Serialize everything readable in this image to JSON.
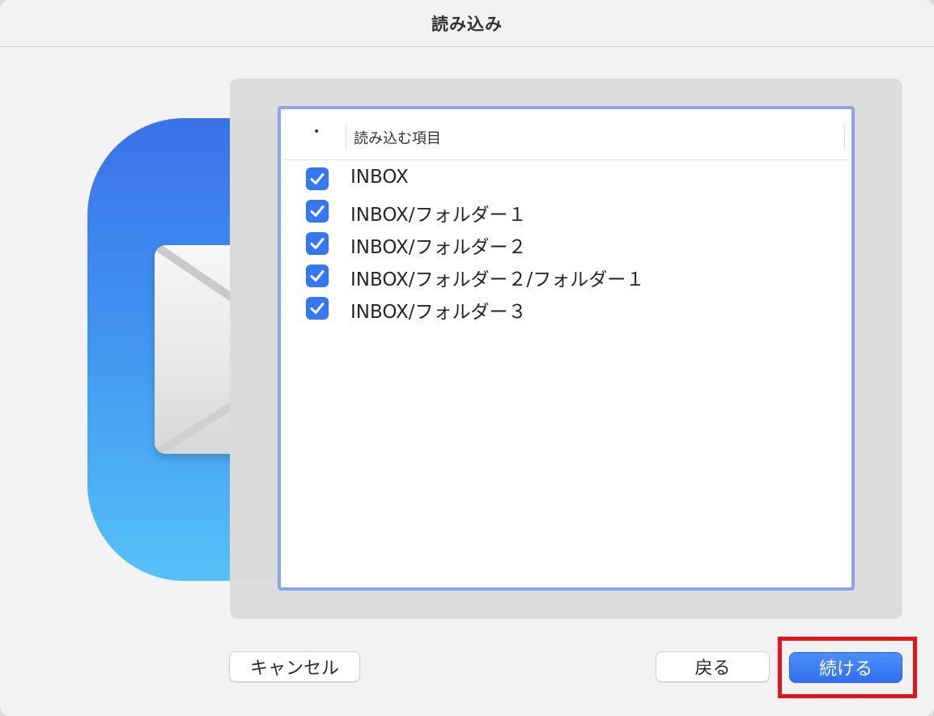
{
  "window": {
    "title": "読み込み"
  },
  "table": {
    "header": {
      "check_col": "•",
      "label": "読み込む項目"
    },
    "items": [
      {
        "label": "INBOX",
        "checked": true
      },
      {
        "label": "INBOX/フォルダー１",
        "checked": true
      },
      {
        "label": "INBOX/フォルダー２",
        "checked": true
      },
      {
        "label": "INBOX/フォルダー２/フォルダー１",
        "checked": true
      },
      {
        "label": "INBOX/フォルダー３",
        "checked": true
      }
    ]
  },
  "buttons": {
    "cancel": "キャンセル",
    "back": "戻る",
    "continue": "続ける"
  },
  "colors": {
    "accent": "#3478f6",
    "table_border": "#8aa5e8",
    "highlight": "#e3141c"
  },
  "icons": {
    "app": "mail-app-icon",
    "checkbox": "checkmark-icon"
  }
}
